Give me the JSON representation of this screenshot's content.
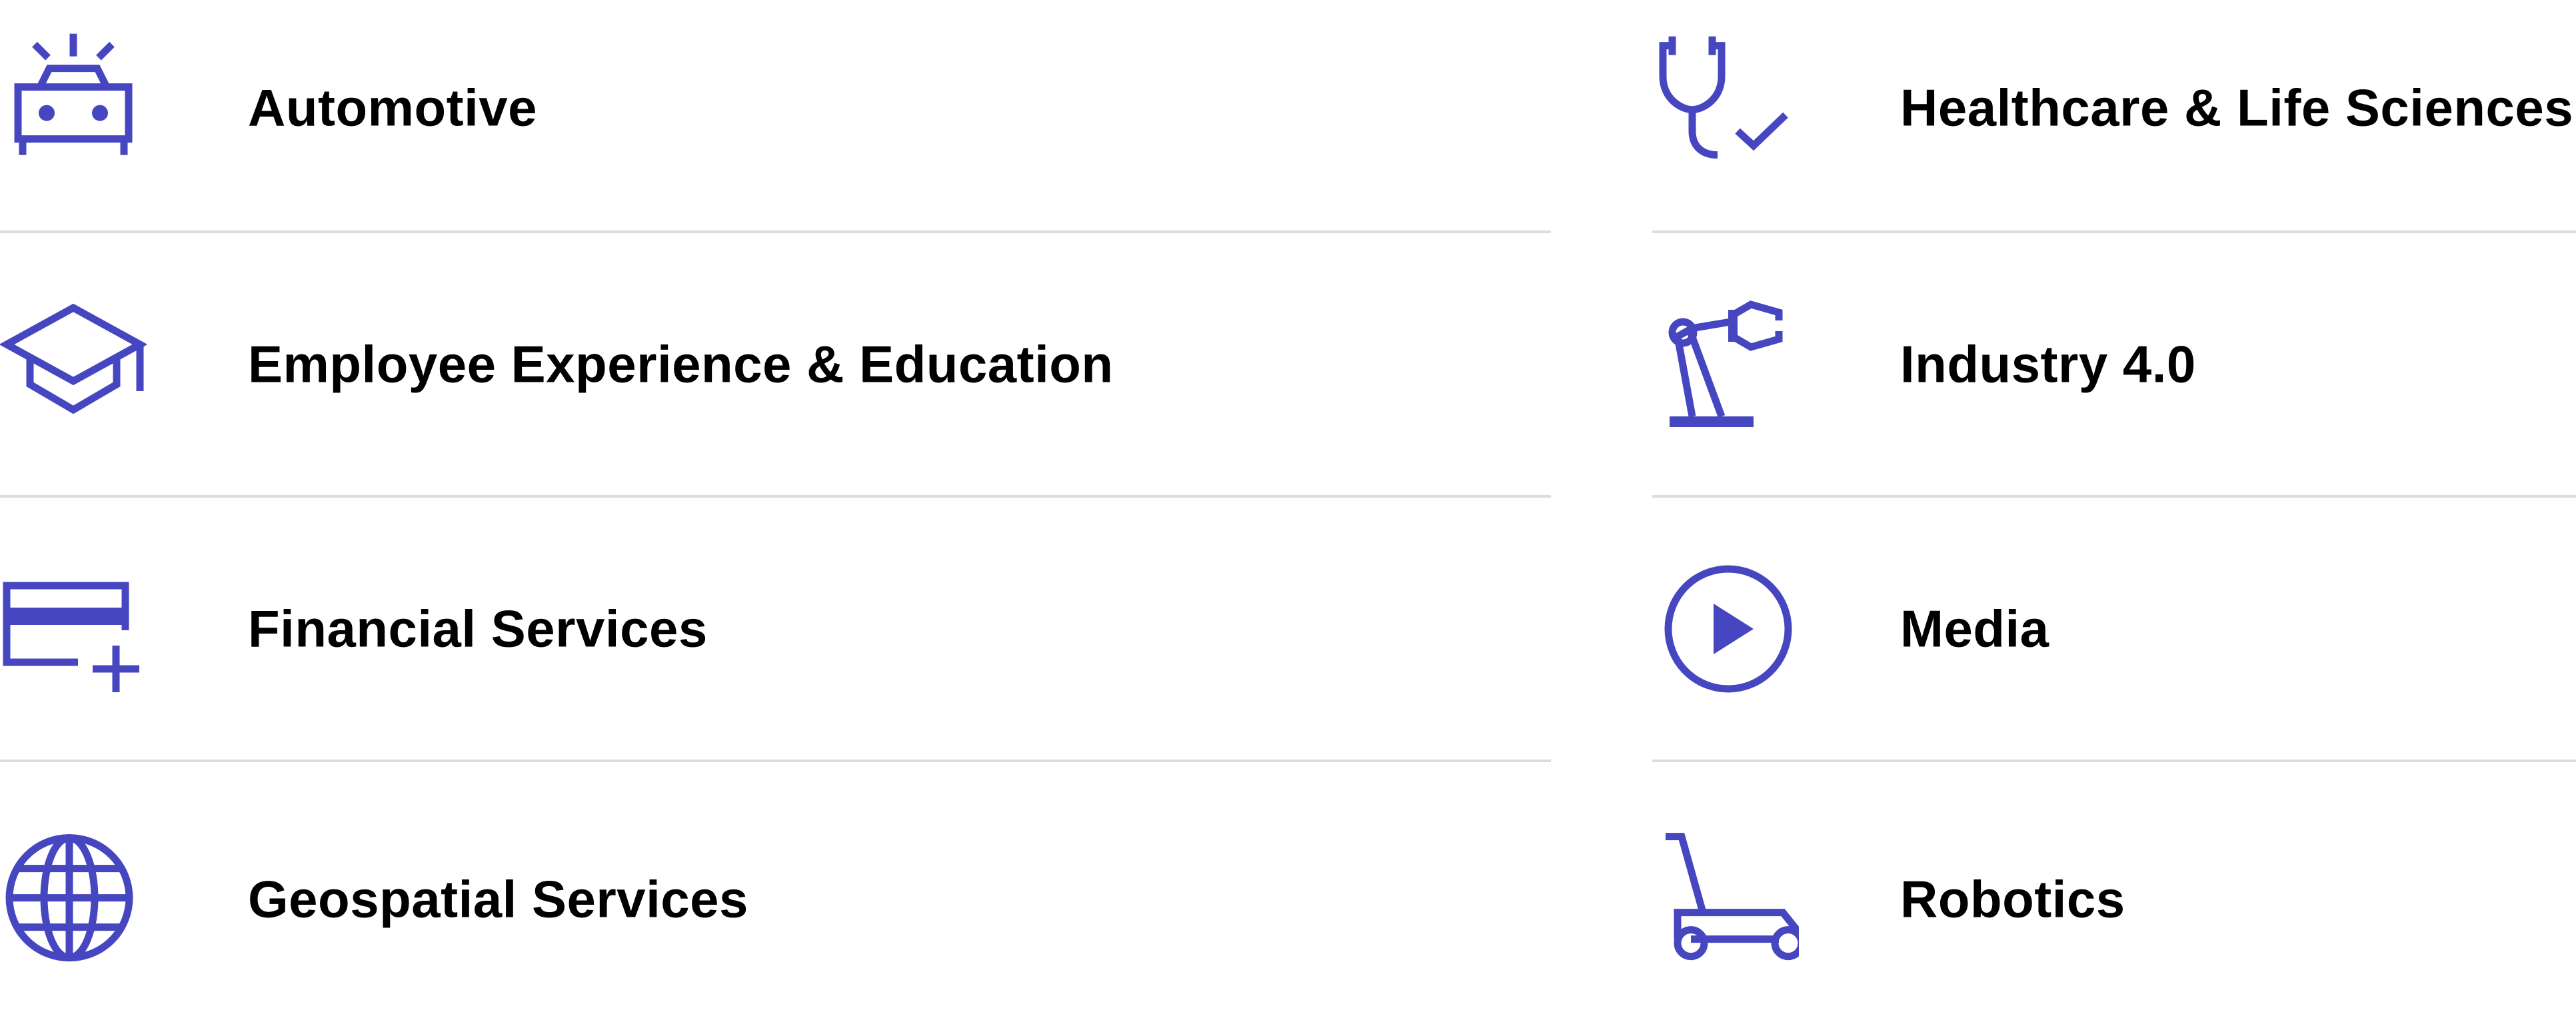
{
  "accent_color": "#4646c0",
  "left_column": [
    {
      "label": "Automotive",
      "icon": "car-icon"
    },
    {
      "label": "Employee Experience & Education",
      "icon": "graduation-cap-icon"
    },
    {
      "label": "Financial Services",
      "icon": "credit-card-plus-icon"
    },
    {
      "label": "Geospatial Services",
      "icon": "globe-icon"
    }
  ],
  "right_column": [
    {
      "label": "Healthcare & Life Sciences",
      "icon": "stethoscope-check-icon"
    },
    {
      "label": "Industry 4.0",
      "icon": "robotic-arm-icon"
    },
    {
      "label": "Media",
      "icon": "play-circle-icon"
    },
    {
      "label": "Robotics",
      "icon": "lawn-mower-icon"
    }
  ]
}
